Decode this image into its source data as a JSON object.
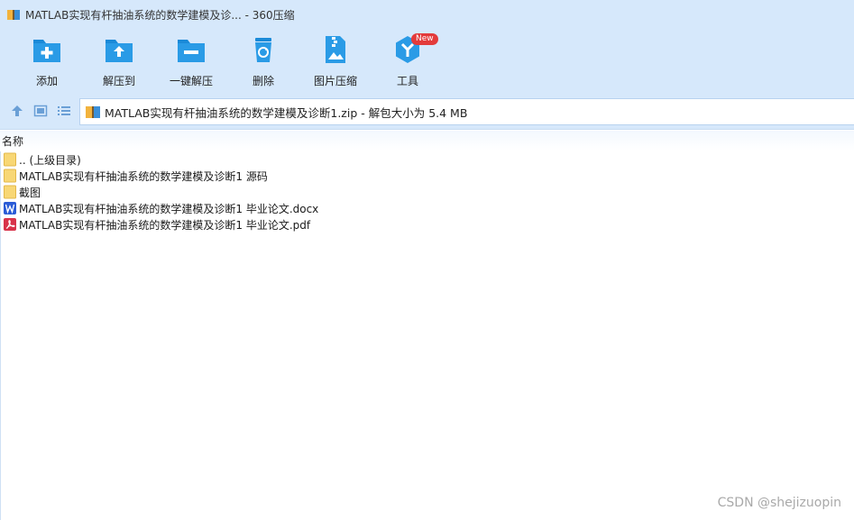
{
  "window": {
    "title": "MATLAB实现有杆抽油系统的数学建模及诊... - 360压缩"
  },
  "toolbar": {
    "add_label": "添加",
    "extract_to_label": "解压到",
    "one_click_extract_label": "一键解压",
    "delete_label": "删除",
    "image_compress_label": "图片压缩",
    "tools_label": "工具",
    "tools_badge": "New"
  },
  "navbar": {
    "path": "MATLAB实现有杆抽油系统的数学建模及诊断1.zip - 解包大小为 5.4 MB"
  },
  "list": {
    "column_name": "名称",
    "items": [
      {
        "name": ".. (上级目录)",
        "icon": "folder-icon"
      },
      {
        "name": "MATLAB实现有杆抽油系统的数学建模及诊断1 源码",
        "icon": "folder-icon"
      },
      {
        "name": "截图",
        "icon": "folder-icon"
      },
      {
        "name": "MATLAB实现有杆抽油系统的数学建模及诊断1 毕业论文.docx",
        "icon": "word-doc-icon"
      },
      {
        "name": "MATLAB实现有杆抽油系统的数学建模及诊断1 毕业论文.pdf",
        "icon": "pdf-icon"
      }
    ]
  },
  "watermark": "CSDN @shejizuopin",
  "colors": {
    "chrome_bg": "#d6e8fb",
    "icon_blue": "#1a8ad8",
    "folder_yellow": "#f8d775",
    "badge_red": "#e33b3b"
  }
}
